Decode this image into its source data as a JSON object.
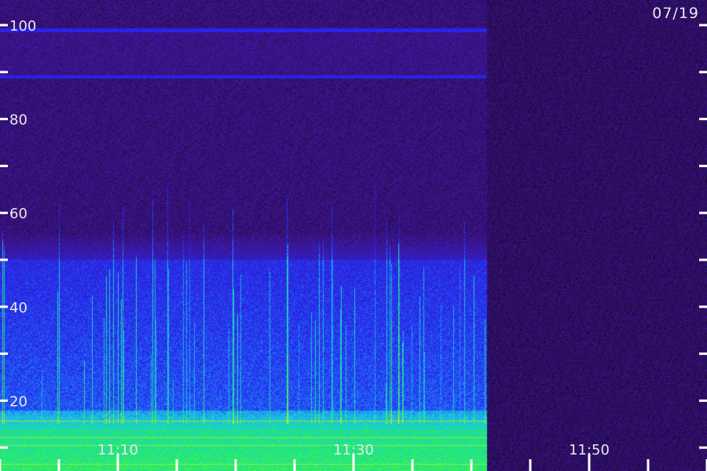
{
  "date_label": "07/19",
  "colors": {
    "background": "#140a26",
    "noise_purple": "#3a1a78",
    "band_blue": "#2222e0",
    "band_cyan": "#20c8e0",
    "band_green": "#20e060",
    "band_yellow": "#e8e020",
    "tick": "#ffffff"
  },
  "chart_data": {
    "type": "heatmap",
    "title": "",
    "xlabel": "",
    "ylabel": "",
    "y_axis": {
      "range": [
        0,
        100
      ],
      "ticks": [
        0,
        10,
        20,
        30,
        40,
        50,
        60,
        70,
        80,
        90,
        100
      ],
      "labels": [
        {
          "value": 20,
          "text": "20"
        },
        {
          "value": 40,
          "text": "40"
        },
        {
          "value": 60,
          "text": "60"
        },
        {
          "value": 80,
          "text": "80"
        },
        {
          "value": 100,
          "text": "100"
        }
      ]
    },
    "x_axis": {
      "labels": [
        {
          "minute": 0,
          "text": "11:10"
        },
        {
          "minute": 20,
          "text": "11:30"
        },
        {
          "minute": 40,
          "text": "11:50"
        }
      ],
      "ticks_every_minutes": 5
    },
    "data_end_minute": 29,
    "features": [
      {
        "kind": "line",
        "value": 99,
        "strength": "medium"
      },
      {
        "kind": "line",
        "value": 89,
        "strength": "medium"
      },
      {
        "kind": "band",
        "from": 50,
        "to": 56,
        "level": "purple"
      },
      {
        "kind": "band",
        "from": 18,
        "to": 50,
        "level": "blue"
      },
      {
        "kind": "band",
        "from": 14,
        "to": 18,
        "level": "cyan-green"
      },
      {
        "kind": "band",
        "from": 5,
        "to": 14,
        "level": "green-yellow"
      }
    ],
    "grid": false,
    "grid_colors": [
      [
        0.06,
        0.02,
        0.14
      ],
      [
        0.25,
        0.08,
        0.55
      ],
      [
        0.15,
        0.15,
        0.95
      ],
      [
        0.1,
        0.75,
        0.95
      ],
      [
        0.15,
        0.95,
        0.35
      ],
      [
        0.95,
        0.92,
        0.1
      ]
    ]
  }
}
